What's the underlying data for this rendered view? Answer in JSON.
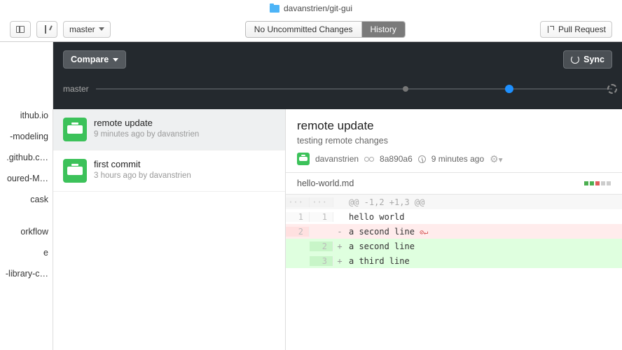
{
  "titlebar": {
    "repo_path": "davanstrien/git-gui"
  },
  "toolbar": {
    "branch": "master",
    "segments": {
      "changes": "No Uncommitted Changes",
      "history": "History"
    },
    "pull_request": "Pull Request"
  },
  "dark": {
    "compare": "Compare",
    "sync": "Sync",
    "timeline_branch": "master"
  },
  "repos": [
    "ithub.io",
    "-modeling",
    ".github.c…",
    "oured-M…",
    "cask",
    "",
    "orkflow",
    "e",
    "-library-c…"
  ],
  "commits": [
    {
      "title": "remote update",
      "sub": "9 minutes ago by davanstrien",
      "selected": true
    },
    {
      "title": "first commit",
      "sub": "3 hours ago by davanstrien",
      "selected": false
    }
  ],
  "detail": {
    "title": "remote update",
    "desc": "testing remote changes",
    "author": "davanstrien",
    "sha": "8a890a6",
    "time": "9 minutes ago",
    "file": "hello-world.md",
    "hunk": "@@ -1,2 +1,3 @@",
    "lines": [
      {
        "type": "ctx",
        "old": "1",
        "new": "1",
        "text": "hello world"
      },
      {
        "type": "del",
        "old": "2",
        "new": "",
        "text": "a second line ",
        "nl": true
      },
      {
        "type": "add",
        "old": "",
        "new": "2",
        "text": "a second line"
      },
      {
        "type": "add",
        "old": "",
        "new": "3",
        "text": "a third line"
      }
    ]
  }
}
